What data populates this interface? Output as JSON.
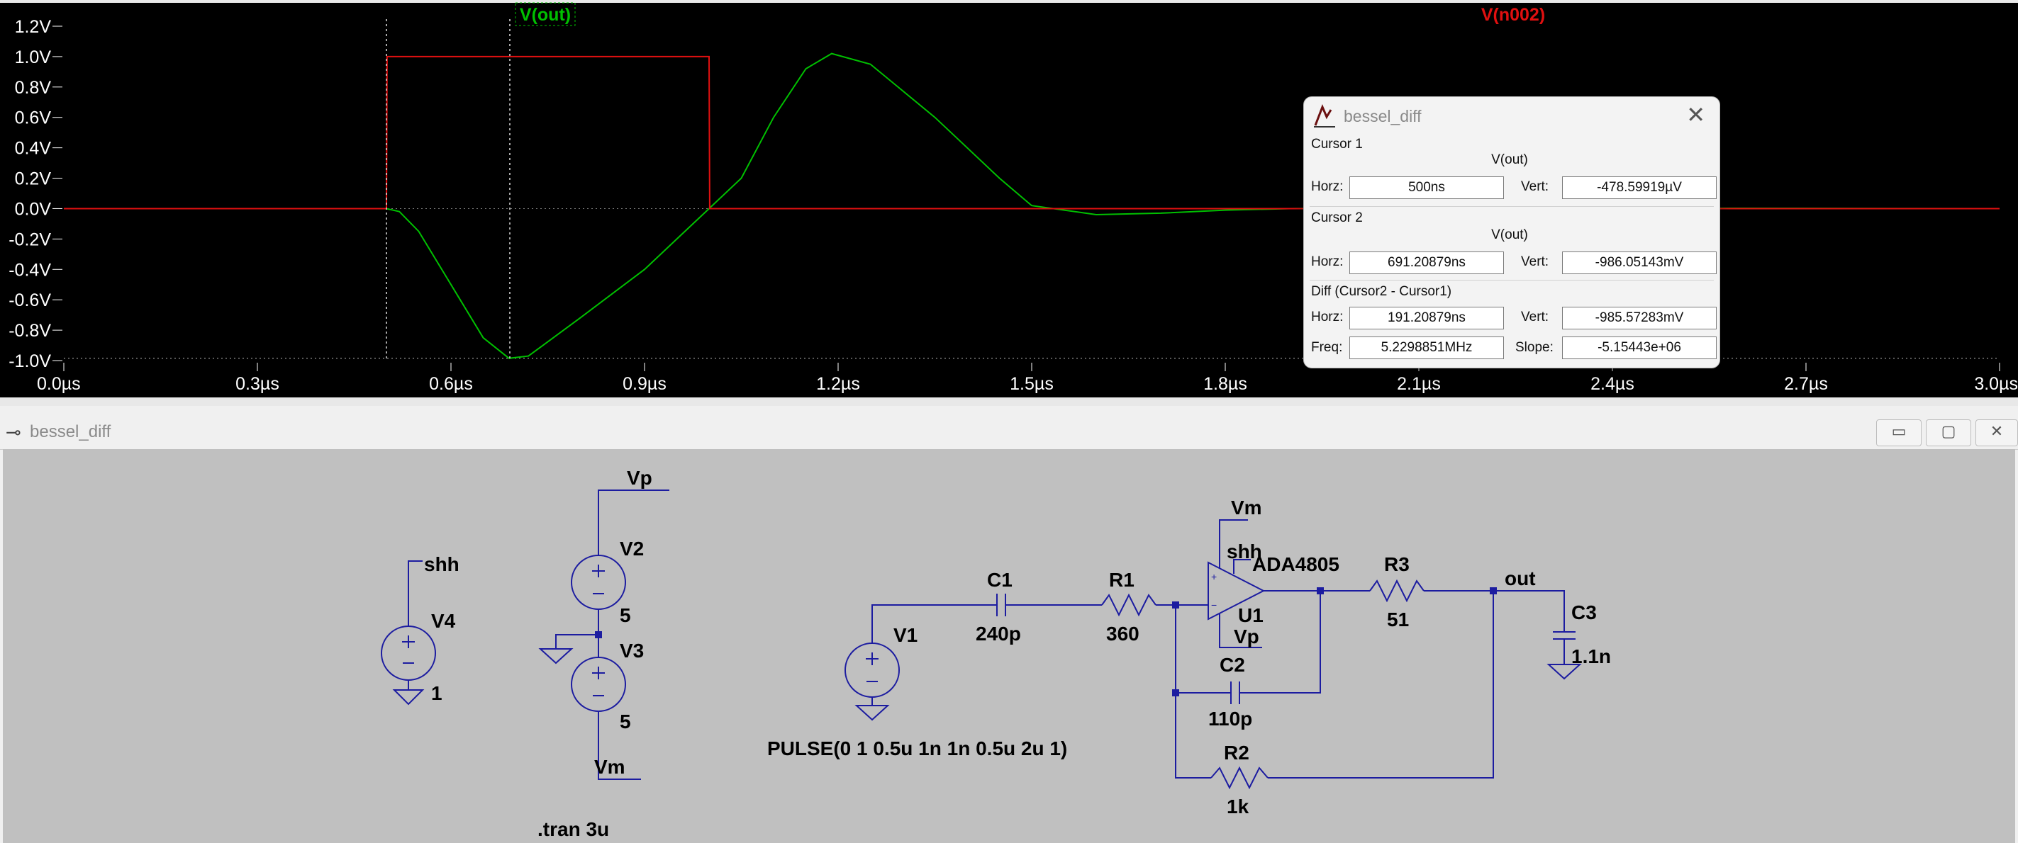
{
  "waveform": {
    "trace_labels": {
      "out": "V(out)",
      "n002": "V(n002)"
    },
    "colors": {
      "out": "#00c000",
      "n002": "#e01010",
      "background": "#000000",
      "axis_text": "#ffffff",
      "grid": "#808080"
    },
    "y_tick_labels": [
      "1.2V",
      "1.0V",
      "0.8V",
      "0.6V",
      "0.4V",
      "0.2V",
      "0.0V",
      "-0.2V",
      "-0.4V",
      "-0.6V",
      "-0.8V",
      "-1.0V"
    ],
    "x_tick_labels": [
      "0.0µs",
      "0.3µs",
      "0.6µs",
      "0.9µs",
      "1.2µs",
      "1.5µs",
      "1.8µs",
      "2.1µs",
      "2.4µs",
      "2.7µs",
      "3.0µs"
    ]
  },
  "chart_data": {
    "type": "line",
    "xlabel": "",
    "ylabel": "",
    "x_unit": "µs",
    "y_unit": "V",
    "xlim": [
      0,
      3.0
    ],
    "ylim": [
      -1.0,
      1.2
    ],
    "y_ticks": [
      1.2,
      1.0,
      0.8,
      0.6,
      0.4,
      0.2,
      0.0,
      -0.2,
      -0.4,
      -0.6,
      -0.8,
      -1.0
    ],
    "x_ticks": [
      0.0,
      0.3,
      0.6,
      0.9,
      1.2,
      1.5,
      1.8,
      2.1,
      2.4,
      2.7,
      3.0
    ],
    "series": [
      {
        "name": "V(out)",
        "color": "#00c000",
        "points": [
          [
            0.0,
            0.0
          ],
          [
            0.5,
            0.0
          ],
          [
            0.52,
            -0.02
          ],
          [
            0.55,
            -0.15
          ],
          [
            0.6,
            -0.5
          ],
          [
            0.65,
            -0.85
          ],
          [
            0.69,
            -0.985
          ],
          [
            0.72,
            -0.97
          ],
          [
            0.8,
            -0.72
          ],
          [
            0.9,
            -0.4
          ],
          [
            0.95,
            -0.2
          ],
          [
            1.0,
            0.0
          ],
          [
            1.05,
            0.2
          ],
          [
            1.1,
            0.6
          ],
          [
            1.15,
            0.92
          ],
          [
            1.19,
            1.02
          ],
          [
            1.25,
            0.95
          ],
          [
            1.35,
            0.6
          ],
          [
            1.45,
            0.2
          ],
          [
            1.5,
            0.02
          ],
          [
            1.6,
            -0.04
          ],
          [
            1.7,
            -0.03
          ],
          [
            1.8,
            -0.01
          ],
          [
            1.9,
            0.0
          ],
          [
            2.0,
            0.005
          ],
          [
            3.0,
            0.0
          ]
        ]
      },
      {
        "name": "V(n002)",
        "color": "#e01010",
        "points": [
          [
            0.0,
            0.0
          ],
          [
            0.5,
            0.0
          ],
          [
            0.501,
            1.0
          ],
          [
            1.0,
            1.0
          ],
          [
            1.001,
            0.0
          ],
          [
            3.0,
            0.0
          ]
        ]
      }
    ],
    "cursors": [
      {
        "x": 0.5,
        "y": -0.000479
      },
      {
        "x": 0.69121,
        "y": -0.986
      }
    ]
  },
  "dialog": {
    "title": "bessel_diff",
    "cursor1": {
      "heading": "Cursor 1",
      "trace": "V(out)",
      "horz_label": "Horz:",
      "horz_value": "500ns",
      "vert_label": "Vert:",
      "vert_value": "-478.59919µV"
    },
    "cursor2": {
      "heading": "Cursor 2",
      "trace": "V(out)",
      "horz_label": "Horz:",
      "horz_value": "691.20879ns",
      "vert_label": "Vert:",
      "vert_value": "-986.05143mV"
    },
    "diff": {
      "heading": "Diff (Cursor2 - Cursor1)",
      "horz_label": "Horz:",
      "horz_value": "191.20879ns",
      "vert_label": "Vert:",
      "vert_value": "-985.57283mV",
      "freq_label": "Freq:",
      "freq_value": "5.2298851MHz",
      "slope_label": "Slope:",
      "slope_value": "-5.15443e+06"
    }
  },
  "schematic_window": {
    "title": "bessel_diff",
    "buttons": {
      "minimize": "▭",
      "maximize": "▢",
      "close": "✕"
    }
  },
  "schematic": {
    "labels": {
      "vp_net": "Vp",
      "v2": "V2",
      "v2_val": "5",
      "v3": "V3",
      "v3_val": "5",
      "vm_net": "Vm",
      "shh_net": "shh",
      "v4": "V4",
      "v4_val": "1",
      "v1": "V1",
      "pulse": "PULSE(0 1 0.5u 1n 1n 0.5u 2u 1)",
      "c1": "C1",
      "c1_val": "240p",
      "r1": "R1",
      "r1_val": "360",
      "opamp_vm": "Vm",
      "opamp_shh": "shh",
      "opamp_model": "ADA4805",
      "opamp_name": "U1",
      "opamp_vp": "Vp",
      "r3": "R3",
      "r3_val": "51",
      "out_net": "out",
      "c3": "C3",
      "c3_val": "1.1n",
      "c2": "C2",
      "c2_val": "110p",
      "r2": "R2",
      "r2_val": "1k",
      "tran": ".tran 3u"
    }
  }
}
